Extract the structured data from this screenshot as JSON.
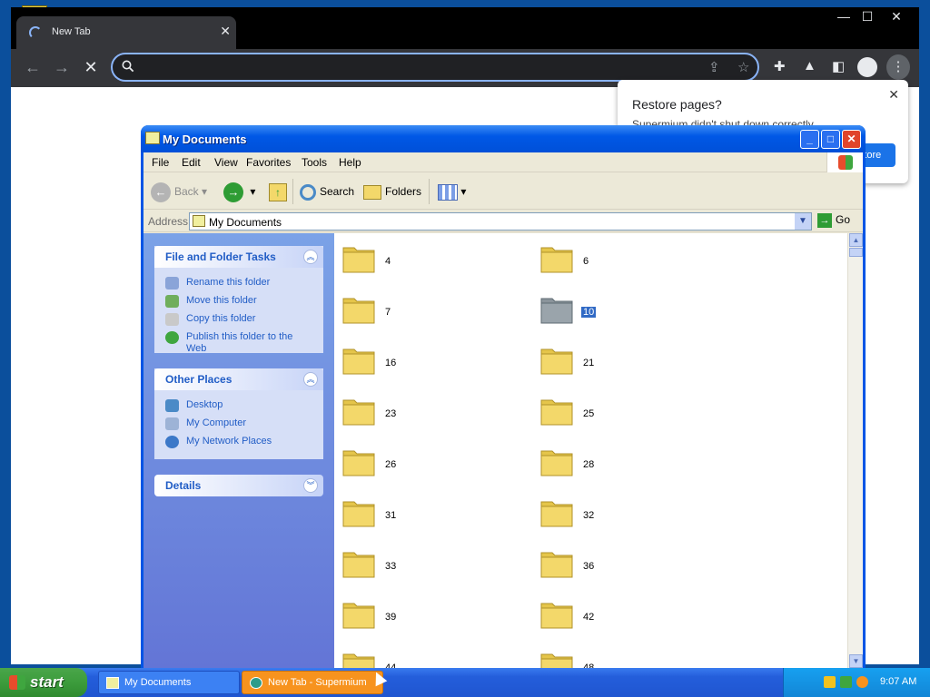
{
  "browser": {
    "tab_title": "New Tab",
    "tab_close": "✕",
    "window_controls": {
      "minimize": "—",
      "maximize": "☐",
      "close": "✕"
    },
    "nav": {
      "back": "←",
      "forward": "→",
      "stop": "✕"
    },
    "omnibox_value": "",
    "restore_popup": {
      "title": "Restore pages?",
      "text": "Supermium didn't shut down correctly.",
      "button": "Restore",
      "close": "✕"
    }
  },
  "explorer": {
    "title": "My Documents",
    "title_buttons": {
      "minimize": "_",
      "maximize": "□",
      "close": "✕"
    },
    "menu": [
      "File",
      "Edit",
      "View",
      "Favorites",
      "Tools",
      "Help"
    ],
    "toolbar": {
      "back": "Back",
      "search": "Search",
      "folders": "Folders"
    },
    "address": {
      "label": "Address",
      "value": "My Documents",
      "go": "Go"
    },
    "tasks": {
      "file_folder": {
        "title": "File and Folder Tasks",
        "items": [
          "Rename this folder",
          "Move this folder",
          "Copy this folder",
          "Publish this folder to the Web"
        ]
      },
      "other_places": {
        "title": "Other Places",
        "items": [
          "Desktop",
          "My Computer",
          "My Network Places"
        ]
      },
      "details": {
        "title": "Details"
      }
    },
    "folders": [
      [
        "4",
        "6"
      ],
      [
        "7",
        "10"
      ],
      [
        "16",
        "21"
      ],
      [
        "23",
        "25"
      ],
      [
        "26",
        "28"
      ],
      [
        "31",
        "32"
      ],
      [
        "33",
        "36"
      ],
      [
        "39",
        "42"
      ],
      [
        "44",
        "48"
      ]
    ],
    "selected_folder": "10"
  },
  "taskbar": {
    "start": "start",
    "tasks": [
      "My Documents",
      "New Tab - Supermium"
    ],
    "active_task": "New Tab - Supermium",
    "clock": "9:07 AM"
  },
  "colors": {
    "xp_blue": "#0055e5",
    "task_pane_blue": "#6375d6",
    "selection": "#316ac5",
    "folder_yellow": "#f3d86a",
    "chrome_dark": "#35363a"
  }
}
